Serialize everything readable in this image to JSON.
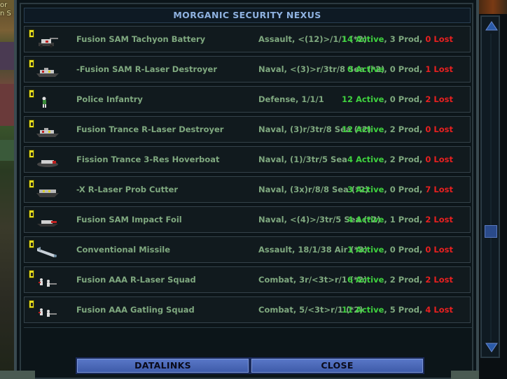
{
  "window": {
    "title": "MORGANIC SECURITY NEXUS"
  },
  "map": {
    "labels": [
      "or",
      "n S"
    ]
  },
  "units": [
    {
      "name": "Fusion SAM Tachyon Battery",
      "stats": "Assault, <(12)>/1/1 (*2)",
      "active": "14 Active",
      "prod": "3 Prod",
      "lost": "0 Lost",
      "icon": "artillery-icon"
    },
    {
      "name": "-Fusion SAM R-Laser Destroyer",
      "stats": "Naval, <(3)>r/3tr/8 Sea (*2)",
      "active": "0 Active",
      "prod": "0 Prod",
      "lost": "1 Lost",
      "icon": "destroyer-icon"
    },
    {
      "name": "Police Infantry",
      "stats": "Defense, 1/1/1",
      "active": "12 Active",
      "prod": "0 Prod",
      "lost": "2 Lost",
      "icon": "infantry-icon"
    },
    {
      "name": "Fusion Trance R-Laser Destroyer",
      "stats": "Naval, (3)r/3tr/8 Sea (*2)",
      "active": "12 Active",
      "prod": "2 Prod",
      "lost": "0 Lost",
      "icon": "destroyer-icon"
    },
    {
      "name": "Fission Trance 3-Res Hoverboat",
      "stats": "Naval, (1)/3tr/5 Sea",
      "active": "4 Active",
      "prod": "2 Prod",
      "lost": "0 Lost",
      "icon": "hoverboat-icon"
    },
    {
      "name": "-X R-Laser Prob Cutter",
      "stats": "Naval, (3x)r/8/8 Sea (*2)",
      "active": "3 Active",
      "prod": "0 Prod",
      "lost": "7 Lost",
      "icon": "cutter-icon"
    },
    {
      "name": "Fusion SAM Impact Foil",
      "stats": "Naval, <(4)>/3tr/5 Sea (*2)",
      "active": "4 Active",
      "prod": "1 Prod",
      "lost": "2 Lost",
      "icon": "foil-icon"
    },
    {
      "name": "Conventional Missile",
      "stats": "Assault, 18/1/38 Air (*3)",
      "active": "1 Active",
      "prod": "0 Prod",
      "lost": "0 Lost",
      "icon": "missile-icon"
    },
    {
      "name": "Fusion AAA R-Laser Squad",
      "stats": "Combat, 3r/<3t>r/1 (*2)",
      "active": "6 Active",
      "prod": "2 Prod",
      "lost": "2 Lost",
      "icon": "squad-icon"
    },
    {
      "name": "Fusion AAA Gatling Squad",
      "stats": "Combat, 5/<3t>r/1 (*2)",
      "active": "11 Active",
      "prod": "5 Prod",
      "lost": "4 Lost",
      "icon": "squad-icon"
    }
  ],
  "buttons": {
    "datalinks": "DATALINKS",
    "close": "CLOSE"
  },
  "colors": {
    "active": "#3fd23f",
    "lost": "#e82020",
    "text": "#7fa87f",
    "title": "#8fb2e0",
    "button": "#4a68b8"
  }
}
